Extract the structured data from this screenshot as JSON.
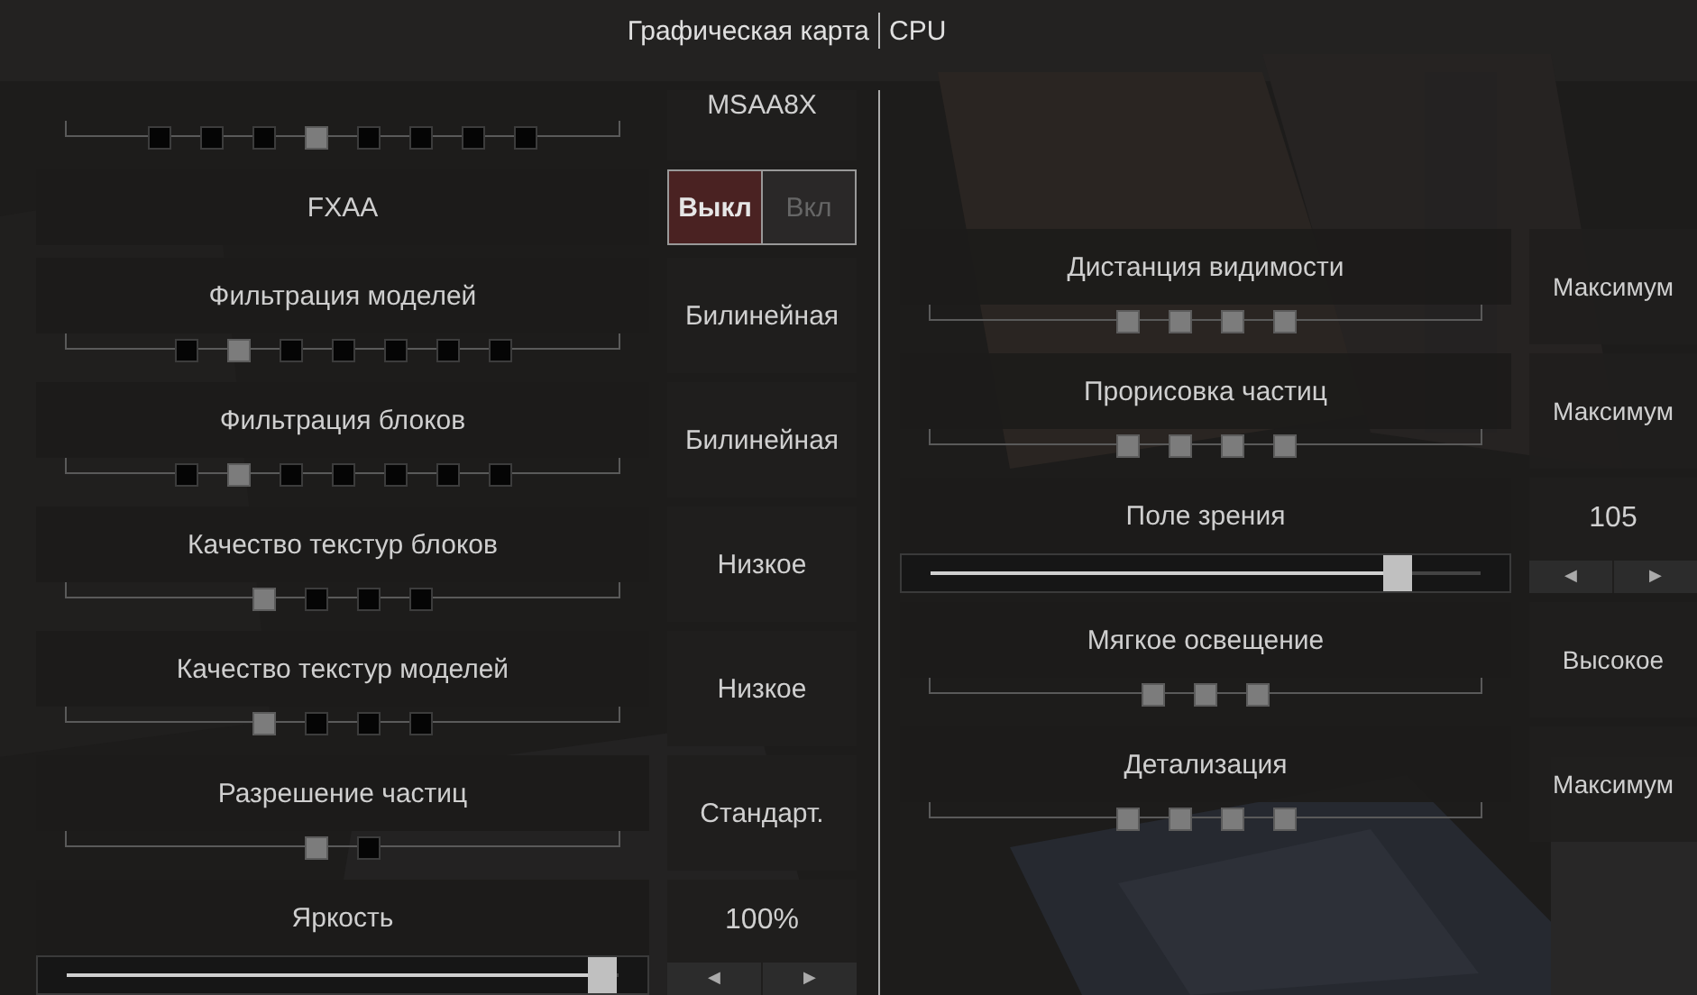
{
  "tabs": [
    "Графическая карта",
    "CPU"
  ],
  "left": [
    {
      "kind": "stepper",
      "value": "MSAA8X",
      "steps": [
        {
          "on": false
        },
        {
          "on": false
        },
        {
          "on": false
        },
        {
          "on": true
        },
        {
          "on": false
        },
        {
          "on": false
        },
        {
          "on": false
        },
        {
          "on": false
        }
      ]
    },
    {
      "kind": "toggle",
      "label": "FXAA",
      "options": [
        {
          "label": "Выкл",
          "selected": true
        },
        {
          "label": "Вкл",
          "selected": false
        }
      ]
    },
    {
      "kind": "stepper",
      "label": "Фильтрация моделей",
      "value": "Билинейная",
      "steps": [
        {
          "on": false
        },
        {
          "on": true
        },
        {
          "on": false
        },
        {
          "on": false
        },
        {
          "on": false
        },
        {
          "on": false
        },
        {
          "on": false
        }
      ]
    },
    {
      "kind": "stepper",
      "label": "Фильтрация блоков",
      "value": "Билинейная",
      "steps": [
        {
          "on": false
        },
        {
          "on": true
        },
        {
          "on": false
        },
        {
          "on": false
        },
        {
          "on": false
        },
        {
          "on": false
        },
        {
          "on": false
        }
      ]
    },
    {
      "kind": "stepper",
      "label": "Качество текстур блоков",
      "value": "Низкое",
      "steps": [
        {
          "on": true
        },
        {
          "on": false
        },
        {
          "on": false
        },
        {
          "on": false
        }
      ]
    },
    {
      "kind": "stepper",
      "label": "Качество текстур моделей",
      "value": "Низкое",
      "steps": [
        {
          "on": true
        },
        {
          "on": false
        },
        {
          "on": false
        },
        {
          "on": false
        }
      ]
    },
    {
      "kind": "stepper",
      "label": "Разрешение частиц",
      "value": "Стандарт.",
      "steps": [
        {
          "on": true
        },
        {
          "on": false
        }
      ]
    },
    {
      "kind": "slider",
      "label": "Яркость",
      "value": "100%",
      "level": 0.97,
      "arrows": [
        "◀",
        "▶"
      ]
    }
  ],
  "right": [
    {
      "kind": "stepper",
      "label": "Дистанция видимости",
      "value": "Максимум",
      "steps": [
        {
          "on": true
        },
        {
          "on": true
        },
        {
          "on": true
        },
        {
          "on": true
        }
      ]
    },
    {
      "kind": "stepper",
      "label": "Прорисовка частиц",
      "value": "Максимум",
      "steps": [
        {
          "on": true
        },
        {
          "on": true
        },
        {
          "on": true
        },
        {
          "on": true
        }
      ]
    },
    {
      "kind": "slider",
      "label": "Поле зрения",
      "value": "105",
      "level": 0.85,
      "arrows": [
        "◀",
        "▶"
      ]
    },
    {
      "kind": "stepper",
      "label": "Мягкое освещение",
      "value": "Высокое",
      "steps": [
        {
          "on": true
        },
        {
          "on": true
        },
        {
          "on": true
        }
      ]
    },
    {
      "kind": "stepper",
      "label": "Детализация",
      "value": "Максимум",
      "steps": [
        {
          "on": true
        },
        {
          "on": true
        },
        {
          "on": true
        },
        {
          "on": true
        }
      ]
    }
  ]
}
